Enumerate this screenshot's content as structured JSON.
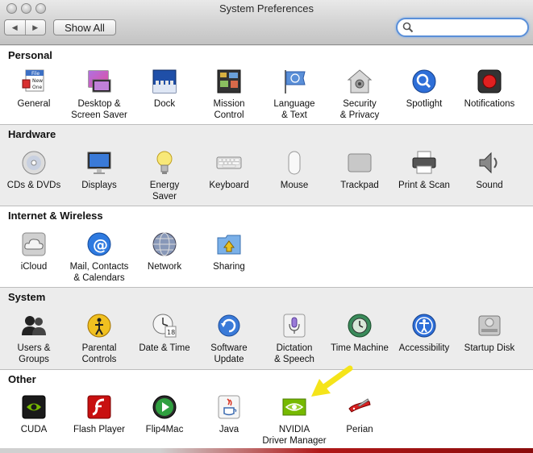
{
  "window": {
    "title": "System Preferences"
  },
  "toolbar": {
    "back": "◀",
    "forward": "▶",
    "show_all": "Show All",
    "search_value": ""
  },
  "sections": [
    {
      "title": "Personal",
      "items": [
        {
          "label": "General",
          "icon": "general-icon"
        },
        {
          "label": "Desktop &\nScreen Saver",
          "icon": "desktop-screensaver-icon"
        },
        {
          "label": "Dock",
          "icon": "dock-icon"
        },
        {
          "label": "Mission\nControl",
          "icon": "mission-control-icon"
        },
        {
          "label": "Language\n& Text",
          "icon": "language-text-icon"
        },
        {
          "label": "Security\n& Privacy",
          "icon": "security-privacy-icon"
        },
        {
          "label": "Spotlight",
          "icon": "spotlight-icon"
        },
        {
          "label": "Notifications",
          "icon": "notifications-icon"
        }
      ]
    },
    {
      "title": "Hardware",
      "items": [
        {
          "label": "CDs & DVDs",
          "icon": "cds-dvds-icon"
        },
        {
          "label": "Displays",
          "icon": "displays-icon"
        },
        {
          "label": "Energy\nSaver",
          "icon": "energy-saver-icon"
        },
        {
          "label": "Keyboard",
          "icon": "keyboard-icon"
        },
        {
          "label": "Mouse",
          "icon": "mouse-icon"
        },
        {
          "label": "Trackpad",
          "icon": "trackpad-icon"
        },
        {
          "label": "Print & Scan",
          "icon": "print-scan-icon"
        },
        {
          "label": "Sound",
          "icon": "sound-icon"
        }
      ]
    },
    {
      "title": "Internet & Wireless",
      "items": [
        {
          "label": "iCloud",
          "icon": "icloud-icon"
        },
        {
          "label": "Mail, Contacts\n& Calendars",
          "icon": "mail-contacts-icon"
        },
        {
          "label": "Network",
          "icon": "network-icon"
        },
        {
          "label": "Sharing",
          "icon": "sharing-icon"
        }
      ]
    },
    {
      "title": "System",
      "items": [
        {
          "label": "Users &\nGroups",
          "icon": "users-groups-icon"
        },
        {
          "label": "Parental\nControls",
          "icon": "parental-controls-icon"
        },
        {
          "label": "Date & Time",
          "icon": "date-time-icon"
        },
        {
          "label": "Software\nUpdate",
          "icon": "software-update-icon"
        },
        {
          "label": "Dictation\n& Speech",
          "icon": "dictation-speech-icon"
        },
        {
          "label": "Time Machine",
          "icon": "time-machine-icon"
        },
        {
          "label": "Accessibility",
          "icon": "accessibility-icon"
        },
        {
          "label": "Startup Disk",
          "icon": "startup-disk-icon"
        }
      ]
    },
    {
      "title": "Other",
      "items": [
        {
          "label": "CUDA",
          "icon": "cuda-icon"
        },
        {
          "label": "Flash Player",
          "icon": "flash-player-icon"
        },
        {
          "label": "Flip4Mac",
          "icon": "flip4mac-icon"
        },
        {
          "label": "Java",
          "icon": "java-icon"
        },
        {
          "label": "NVIDIA\nDriver Manager",
          "icon": "nvidia-driver-manager-icon"
        },
        {
          "label": "Perian",
          "icon": "perian-icon"
        }
      ]
    }
  ],
  "colors": {
    "search_focus": "#5a8fd8",
    "highlight_arrow": "#f5e41a"
  }
}
